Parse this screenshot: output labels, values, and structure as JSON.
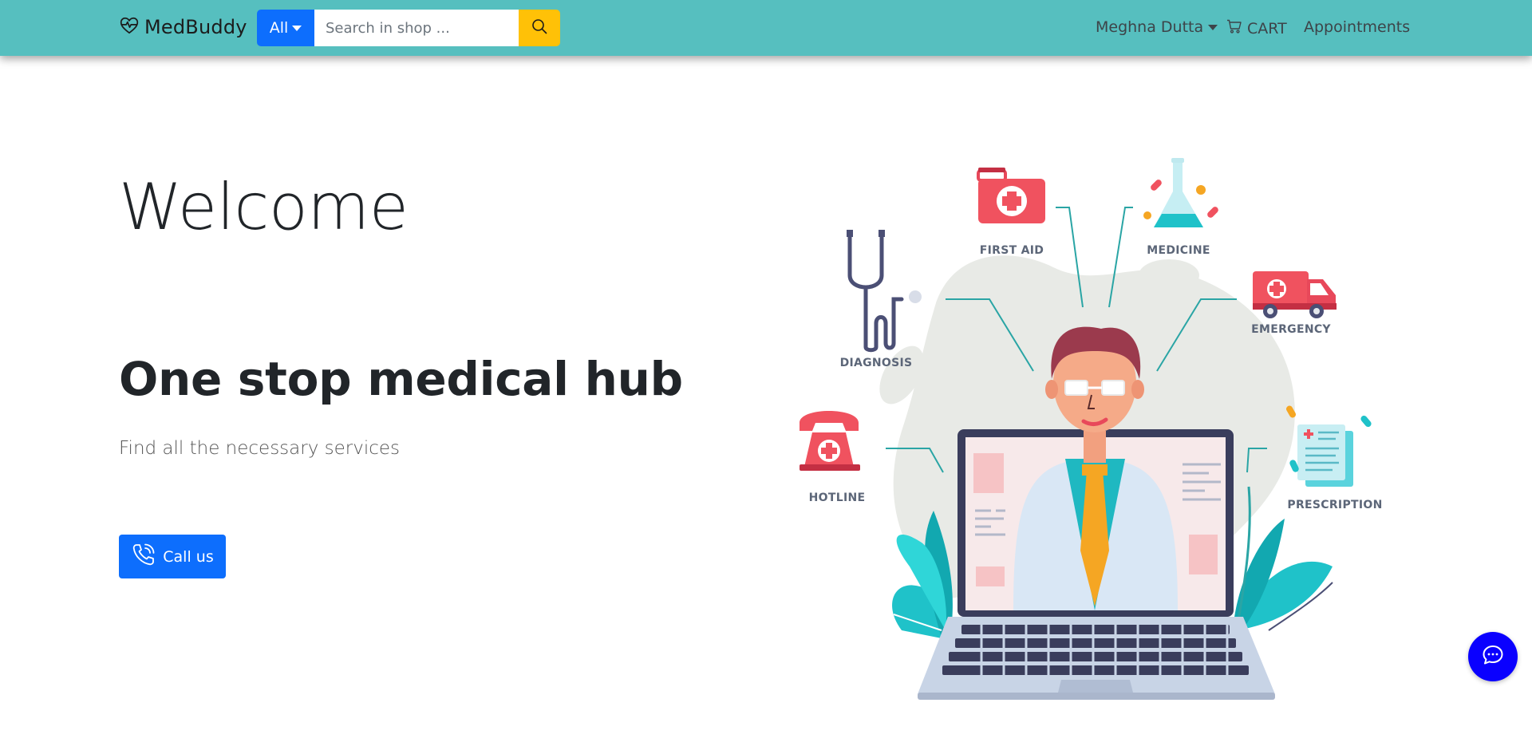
{
  "navbar": {
    "brand": "MedBuddy",
    "category_dropdown": "All",
    "search_placeholder": "Search in shop ...",
    "search_value": "",
    "user_menu": "Meghna Dutta",
    "cart_label": "CART",
    "appointments_label": "Appointments"
  },
  "hero": {
    "welcome": "Welcome",
    "tagline": "One stop medical hub",
    "subtitle": "Find all the necessary services",
    "call_button": "Call us"
  },
  "illustration": {
    "labels": {
      "first_aid": "FIRST AID",
      "medicine": "MEDICINE",
      "diagnosis": "DIAGNOSIS",
      "emergency": "EMERGENCY",
      "hotline": "HOTLINE",
      "prescription": "PRESCRIPTION"
    }
  },
  "icons": {
    "brand": "heart-pulse-icon",
    "search": "search-icon",
    "cart": "cart-icon",
    "call": "phone-icon",
    "chat": "chat-icon"
  },
  "colors": {
    "navbar": "#56bfbf",
    "primary": "#0d6efd",
    "search_button": "#ffc107",
    "chat_button": "#0a00ff"
  }
}
